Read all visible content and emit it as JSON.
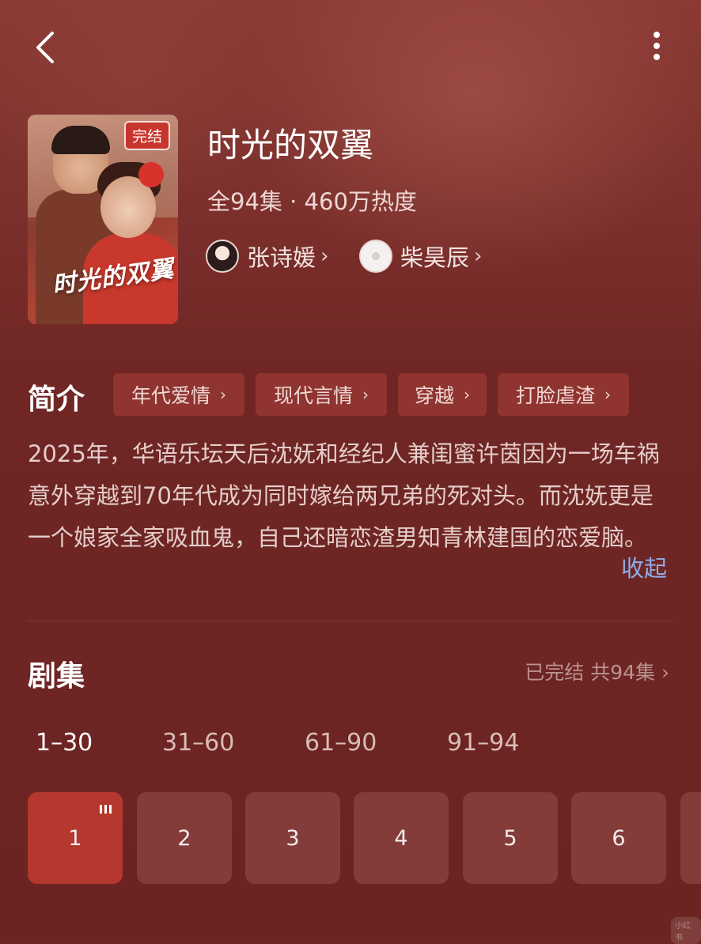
{
  "header": {
    "back_icon": "chevron-left-icon",
    "more_icon": "vertical-dots-icon"
  },
  "drama": {
    "poster_title_art": "时光的双翼",
    "status_badge": "完结",
    "title": "时光的双翼",
    "meta": "全94集 · 460万热度",
    "cast": [
      {
        "name": "张诗媛",
        "chevron": "›"
      },
      {
        "name": "柴昊辰",
        "chevron": "›"
      }
    ]
  },
  "intro": {
    "label": "简介",
    "tags": [
      "年代爱情",
      "现代言情",
      "穿越",
      "打脸虐渣"
    ],
    "tag_arrow": "›",
    "description": "2025年，华语乐坛天后沈妩和经纪人兼闺蜜许茵因为一场车祸意外穿越到70年代成为同时嫁给两兄弟的死对头。而沈妩更是一个娘家全家吸血鬼，自己还暗恋渣男知青林建国的恋爱脑。",
    "collapse": "收起"
  },
  "episodes": {
    "label": "剧集",
    "status": "已完结 共94集 ›",
    "ranges": [
      "1–30",
      "31–60",
      "61–90",
      "91–94"
    ],
    "active_range": 0,
    "items": [
      "1",
      "2",
      "3",
      "4",
      "5",
      "6"
    ],
    "active_item": 0
  },
  "watermark": "小红书"
}
